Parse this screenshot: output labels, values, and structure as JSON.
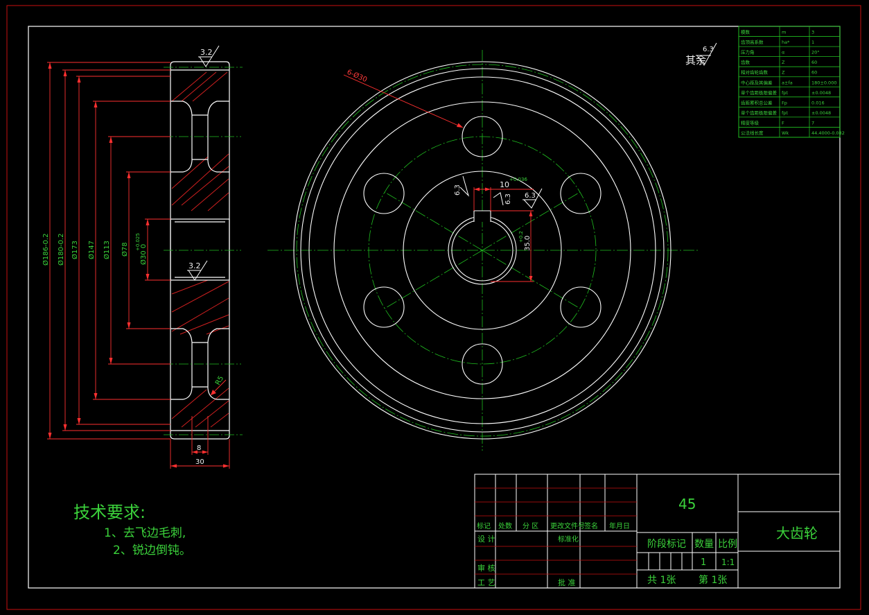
{
  "colors": {
    "background": "#000000",
    "outline": "#ffffff",
    "frame_red": "#c81010",
    "dimension_red": "#ff3030",
    "text_green": "#3bd23b",
    "centerline_green": "#20c020",
    "hatch_red": "#d02020"
  },
  "roughness": {
    "other": "其余",
    "other_value": "6.3",
    "side_top": "3.2",
    "side_bore": "3.2",
    "keyway_left": "6.3",
    "keyway_right": "6.3",
    "keyway_bottom": "6.3"
  },
  "side_view": {
    "dims": {
      "d186": "Ø186-0.2",
      "d180": "Ø180-0.2",
      "d173": "Ø173",
      "d147": "Ø147",
      "d113": "Ø113",
      "d78": "Ø78",
      "d30": "Ø30 0",
      "d30_tol": "+0.025",
      "r5": "R5",
      "width_8": "8",
      "width_30": "30"
    }
  },
  "front_view": {
    "holes_label": "6-Ø30",
    "keyway_width": "10",
    "keyway_tol": "+0.036",
    "keyway_depth": "35.0",
    "keyway_depth_tol": "+0.2"
  },
  "gear_table": {
    "rows": [
      {
        "name": "模数",
        "sym": "m",
        "value": "3"
      },
      {
        "name": "齿顶高系数",
        "sym": "ha*",
        "value": "1"
      },
      {
        "name": "压力角",
        "sym": "α",
        "value": "20°"
      },
      {
        "name": "齿数",
        "sym": "Z",
        "value": "60"
      },
      {
        "name": "相对齿轮齿数",
        "sym": "Z",
        "value": "60"
      },
      {
        "name": "中心距及其偏差",
        "sym": "a±fa",
        "value": "180±0.000"
      },
      {
        "name": "单个齿距极限偏差",
        "sym": "fpt",
        "value": "±0.0048"
      },
      {
        "name": "齿距累积总公差",
        "sym": "Fp",
        "value": "0.016"
      },
      {
        "name": "单个齿距极限偏差",
        "sym": "fpt",
        "value": "±0.0048"
      },
      {
        "name": "精度等级",
        "sym": "F",
        "value": "7"
      },
      {
        "name": "公法线长度",
        "sym": "Wk",
        "value": "44.4000-0.082"
      }
    ]
  },
  "requirements": {
    "title": "技术要求:",
    "items": [
      "1、去飞边毛刺,",
      "2、锐边倒钝。"
    ]
  },
  "title_block": {
    "material": "45",
    "part_name": "大齿轮",
    "header_labels": [
      "标记",
      "处数",
      "分 区",
      "更改文件号",
      "签名",
      "年月日"
    ],
    "design": "设 计",
    "standardize": "标准化",
    "review": "审 核",
    "process": "工 艺",
    "approve": "批 准",
    "stage_label": "阶段标记",
    "qty_label": "数量",
    "scale_label": "比例",
    "qty_value": "1",
    "scale_value": "1:1",
    "sheets_total": "共  1张",
    "sheet_no": "第  1张"
  }
}
